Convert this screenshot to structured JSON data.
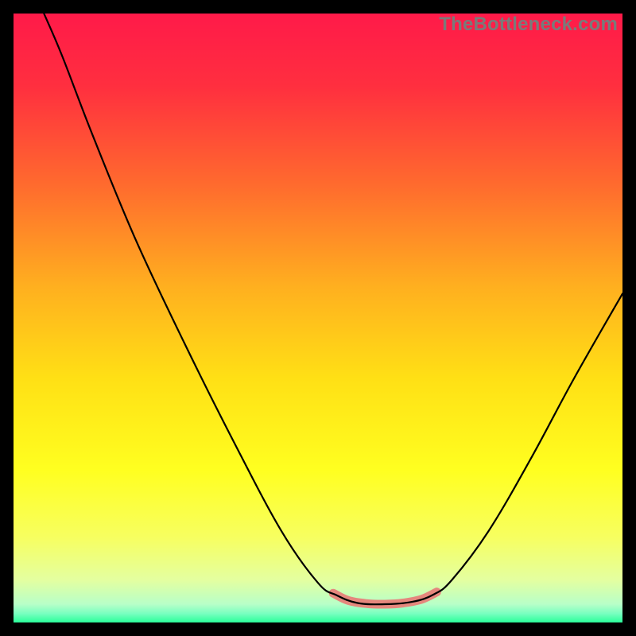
{
  "watermark": "TheBottleneck.com",
  "chart_data": {
    "type": "line",
    "title": "",
    "xlabel": "",
    "ylabel": "",
    "xlim": [
      0,
      100
    ],
    "ylim": [
      0,
      100
    ],
    "gradient_stops": [
      {
        "offset": 0.0,
        "color": "#ff1a49"
      },
      {
        "offset": 0.12,
        "color": "#ff2f3f"
      },
      {
        "offset": 0.28,
        "color": "#ff6a2e"
      },
      {
        "offset": 0.45,
        "color": "#ffb01f"
      },
      {
        "offset": 0.6,
        "color": "#ffe015"
      },
      {
        "offset": 0.75,
        "color": "#ffff20"
      },
      {
        "offset": 0.86,
        "color": "#f7ff60"
      },
      {
        "offset": 0.93,
        "color": "#e4ffa0"
      },
      {
        "offset": 0.97,
        "color": "#b8ffc8"
      },
      {
        "offset": 0.985,
        "color": "#7affc0"
      },
      {
        "offset": 1.0,
        "color": "#2aff9a"
      }
    ],
    "series": [
      {
        "name": "bottleneck-curve",
        "stroke": "#000000",
        "stroke_width": 2.2,
        "points": [
          {
            "x": 5.0,
            "y": 100.0
          },
          {
            "x": 8.0,
            "y": 93.0
          },
          {
            "x": 13.0,
            "y": 80.0
          },
          {
            "x": 20.0,
            "y": 63.0
          },
          {
            "x": 28.0,
            "y": 46.0
          },
          {
            "x": 36.0,
            "y": 30.0
          },
          {
            "x": 44.0,
            "y": 15.0
          },
          {
            "x": 50.0,
            "y": 6.5
          },
          {
            "x": 53.0,
            "y": 4.5
          },
          {
            "x": 56.5,
            "y": 3.2
          },
          {
            "x": 61.0,
            "y": 3.0
          },
          {
            "x": 65.5,
            "y": 3.4
          },
          {
            "x": 69.0,
            "y": 4.6
          },
          {
            "x": 72.0,
            "y": 7.0
          },
          {
            "x": 78.0,
            "y": 15.0
          },
          {
            "x": 85.0,
            "y": 27.0
          },
          {
            "x": 92.0,
            "y": 40.0
          },
          {
            "x": 100.0,
            "y": 54.0
          }
        ]
      },
      {
        "name": "highlight-band",
        "stroke": "#e5877d",
        "stroke_width": 11,
        "points": [
          {
            "x": 52.5,
            "y": 4.8
          },
          {
            "x": 55.0,
            "y": 3.6
          },
          {
            "x": 58.0,
            "y": 3.1
          },
          {
            "x": 61.0,
            "y": 3.0
          },
          {
            "x": 64.0,
            "y": 3.2
          },
          {
            "x": 67.0,
            "y": 3.8
          },
          {
            "x": 69.5,
            "y": 5.0
          }
        ]
      }
    ]
  }
}
